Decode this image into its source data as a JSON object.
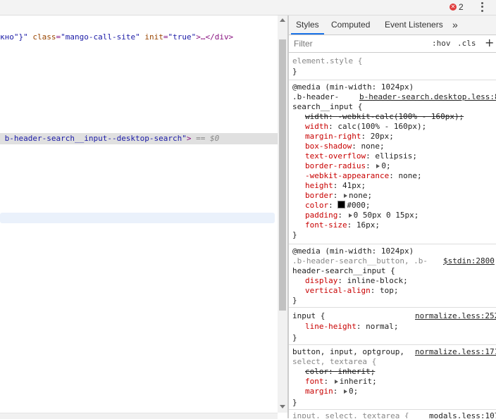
{
  "topbar": {
    "error_count": "2",
    "error_icon": "✕"
  },
  "elements": {
    "line1": {
      "pre": "кно\"}\" ",
      "attr1_name": "class",
      "eq1": "=",
      "attr1_val": "\"mango-call-site\"",
      "sp": " ",
      "attr2_name": "init",
      "eq2": "=",
      "attr2_val": "\"true\"",
      "close": ">…</div>"
    },
    "selected": {
      "val": "b-header-search__input--desktop-search\"",
      "close": ">",
      "marker": " == $0"
    }
  },
  "styles": {
    "tabs": [
      "Styles",
      "Computed",
      "Event Listeners",
      "»"
    ],
    "filter_placeholder": "Filter",
    "hov": ":hov",
    "cls": ".cls",
    "plus": "+",
    "rules": {
      "element": {
        "selector": "element.style {",
        "close": "}"
      },
      "r1": {
        "media": "@media (min-width: 1024px)",
        "sel1": ".b-header-",
        "source": "b-header-search.desktop.less:8",
        "sel2": "search__input {",
        "decls": [
          {
            "name": "width",
            "value": "-webkit-calc(100% - 160px);",
            "struck": true
          },
          {
            "name": "width",
            "value": "calc(100% - 160px);"
          },
          {
            "name": "margin-right",
            "value": "20px;"
          },
          {
            "name": "box-shadow",
            "value": "none;"
          },
          {
            "name": "text-overflow",
            "value": "ellipsis;"
          },
          {
            "name": "border-radius",
            "value": "0;",
            "expand": true
          },
          {
            "name": "-webkit-appearance",
            "value": "none;"
          },
          {
            "name": "height",
            "value": "41px;"
          },
          {
            "name": "border",
            "value": "none;",
            "expand": true
          },
          {
            "name": "color",
            "value": "#000;",
            "swatch": "#000000"
          },
          {
            "name": "padding",
            "value": "0 50px 0 15px;",
            "expand": true
          },
          {
            "name": "font-size",
            "value": "16px;"
          }
        ],
        "close": "}"
      },
      "r2": {
        "media": "@media (min-width: 1024px)",
        "sel1": ".b-header-search__button, .b-",
        "source": "$stdin:2800",
        "sel2": "header-search__input {",
        "decls": [
          {
            "name": "display",
            "value": "inline-block;"
          },
          {
            "name": "vertical-align",
            "value": "top;"
          }
        ],
        "close": "}"
      },
      "r3": {
        "sel1": "input {",
        "source": "normalize.less:252",
        "decls": [
          {
            "name": "line-height",
            "value": "normal;"
          }
        ],
        "close": "}"
      },
      "r4": {
        "sel1": "button, input, optgroup,",
        "source": "normalize.less:171",
        "sel2": "select, textarea {",
        "decls": [
          {
            "name": "color",
            "value": "inherit;",
            "struck": true
          },
          {
            "name": "font",
            "value": "inherit;",
            "expand": true
          },
          {
            "name": "margin",
            "value": "0;",
            "expand": true
          }
        ],
        "close": "}"
      },
      "r5": {
        "sel1": "input, select, textarea {",
        "source": "modals.less:107"
      }
    }
  }
}
